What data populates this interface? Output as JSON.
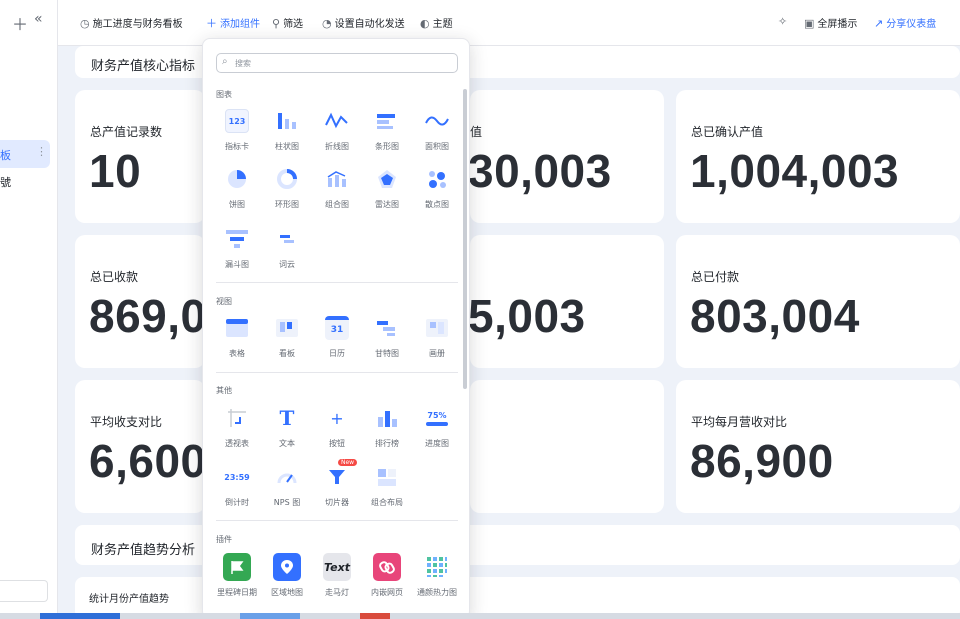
{
  "sidebar": {
    "add_icon": "plus-icon",
    "collapse_icon": "double-chevron-left-icon",
    "items": [
      {
        "label": "板",
        "active": true
      },
      {
        "label": "號",
        "active": false
      }
    ],
    "more_icon": "more-vertical-icon"
  },
  "toolbar": {
    "dashboard_title": "施工进度与财务看板",
    "add_component": "添加组件",
    "filter": "筛选",
    "auto_send": "设置自动化发送",
    "theme": "主题",
    "fullscreen": "全屏播示",
    "share": "分享仪表盘"
  },
  "sections": {
    "core_title": "财务产值核心指标",
    "trend_title": "财务产值趋势分析",
    "trend_sub": "统计月份产值趋势"
  },
  "cards": [
    {
      "label": "总产值记录数",
      "value": "10"
    },
    {
      "label": "值",
      "value": "30,003"
    },
    {
      "label": "总已确认产值",
      "value": "1,004,003"
    },
    {
      "label": "总已收款",
      "value": "869,0"
    },
    {
      "label": "",
      "value": "5,003"
    },
    {
      "label": "总已付款",
      "value": "803,004"
    },
    {
      "label": "平均收支对比",
      "value": "6,600"
    },
    {
      "label": "",
      "value": ""
    },
    {
      "label": "平均每月营收对比",
      "value": "86,900"
    }
  ],
  "dropdown": {
    "search_placeholder": "搜索",
    "groups": {
      "charts": "图表",
      "views": "视图",
      "others": "其他",
      "plugins": "插件"
    },
    "charts": [
      "指标卡",
      "柱状图",
      "折线图",
      "条形图",
      "面积图",
      "饼图",
      "环形图",
      "组合图",
      "雷达图",
      "散点图",
      "漏斗图",
      "词云"
    ],
    "views": [
      "表格",
      "看板",
      "日历",
      "甘特图",
      "画册"
    ],
    "others": [
      "透视表",
      "文本",
      "按钮",
      "排行榜",
      "进度图",
      "倒计时",
      "NPS 图",
      "切片器",
      "组合布局"
    ],
    "others_badge": "New",
    "plugins": [
      "里程碑日期",
      "区域地图",
      "走马灯",
      "内嵌网页",
      "通颜热力图"
    ],
    "icon_texts": {
      "indicator": "123",
      "calendar": "31",
      "progress": "75%",
      "countdown": "23:59",
      "text": "T",
      "marquee": "Text"
    }
  },
  "colors": {
    "accent": "#3370ff",
    "value_text": "#2b2f36",
    "bg": "#eef2f9"
  }
}
